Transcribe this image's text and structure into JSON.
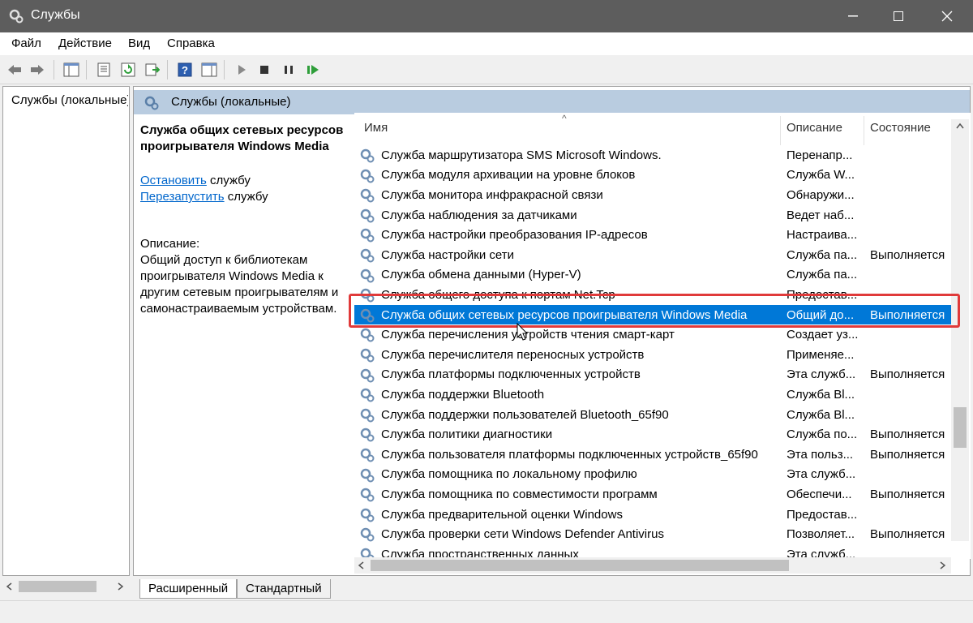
{
  "window": {
    "title": "Службы",
    "minimize": "—",
    "maximize": "☐",
    "close": "✕"
  },
  "menu": [
    "Файл",
    "Действие",
    "Вид",
    "Справка"
  ],
  "tree": {
    "item_label": "Службы (локальные)"
  },
  "pane_header": "Службы (локальные)",
  "details": {
    "title_line1": "Служба общих сетевых ресурсов",
    "title_line2": "проигрывателя Windows Media",
    "stop_link": "Остановить",
    "stop_suffix": " службу",
    "restart_link": "Перезапустить",
    "restart_suffix": " службу",
    "desc_label": "Описание:",
    "desc_lines": [
      "Общий доступ к библиотекам",
      "проигрывателя Windows Media к",
      "другим сетевым проигрывателям и",
      "самонастраиваемым устройствам."
    ]
  },
  "columns": {
    "name": "Имя",
    "description": "Описание",
    "state": "Состояние"
  },
  "services": [
    {
      "name": "Служба маршрутизатора SMS Microsoft Windows.",
      "desc": "Перенапр...",
      "state": ""
    },
    {
      "name": "Служба модуля архивации на уровне блоков",
      "desc": "Служба W...",
      "state": ""
    },
    {
      "name": "Служба монитора инфракрасной связи",
      "desc": "Обнаружи...",
      "state": ""
    },
    {
      "name": "Служба наблюдения за датчиками",
      "desc": "Ведет наб...",
      "state": ""
    },
    {
      "name": "Служба настройки преобразования IP-адресов",
      "desc": "Настраива...",
      "state": ""
    },
    {
      "name": "Служба настройки сети",
      "desc": "Служба па...",
      "state": "Выполняется"
    },
    {
      "name": "Служба обмена данными (Hyper-V)",
      "desc": "Служба па...",
      "state": ""
    },
    {
      "name": "Служба общего доступа к портам Net.Tcp",
      "desc": "Предостав...",
      "state": ""
    },
    {
      "name": "Служба общих сетевых ресурсов проигрывателя Windows Media",
      "desc": "Общий до...",
      "state": "Выполняется",
      "selected": true
    },
    {
      "name": "Служба перечисления устройств чтения смарт-карт",
      "desc": "Создает уз...",
      "state": ""
    },
    {
      "name": "Служба перечислителя переносных устройств",
      "desc": "Применяе...",
      "state": ""
    },
    {
      "name": "Служба платформы подключенных устройств",
      "desc": "Эта служб...",
      "state": "Выполняется"
    },
    {
      "name": "Служба поддержки Bluetooth",
      "desc": "Служба Bl...",
      "state": ""
    },
    {
      "name": "Служба поддержки пользователей Bluetooth_65f90",
      "desc": "Служба Bl...",
      "state": ""
    },
    {
      "name": "Служба политики диагностики",
      "desc": "Служба по...",
      "state": "Выполняется"
    },
    {
      "name": "Служба пользователя платформы подключенных устройств_65f90",
      "desc": "Эта польз...",
      "state": "Выполняется"
    },
    {
      "name": "Служба помощника по локальному профилю",
      "desc": "Эта служб...",
      "state": ""
    },
    {
      "name": "Служба помощника по совместимости программ",
      "desc": "Обеспечи...",
      "state": "Выполняется"
    },
    {
      "name": "Служба предварительной оценки Windows",
      "desc": "Предостав...",
      "state": ""
    },
    {
      "name": "Служба проверки сети Windows Defender Antivirus",
      "desc": "Позволяет...",
      "state": "Выполняется"
    },
    {
      "name": "Служба пространственных данных",
      "desc": "Эта служб...",
      "state": ""
    }
  ],
  "tabs": [
    "Расширенный",
    "Стандартный"
  ],
  "colors": {
    "titlebar": "#5d5d5d",
    "selection": "#0078d7",
    "highlight": "#e03a3a",
    "pane_header": "#b9cce0",
    "link": "#0066cc"
  }
}
